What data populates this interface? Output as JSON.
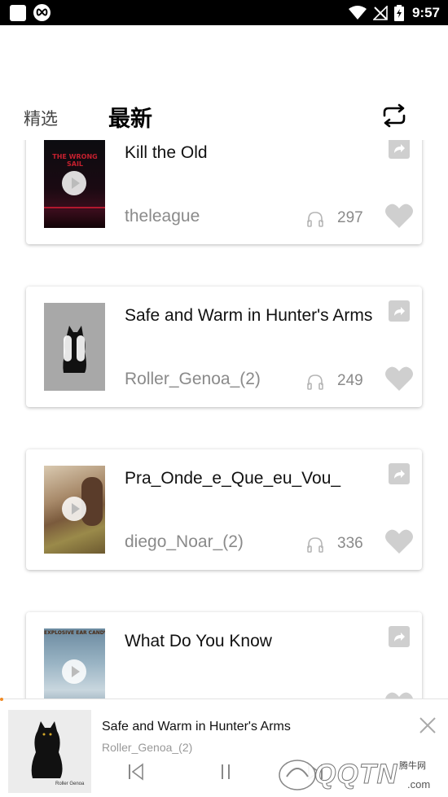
{
  "status_bar": {
    "time": "9:57"
  },
  "tabs": {
    "featured": "精选",
    "latest": "最新"
  },
  "tracks": [
    {
      "title": "Kill the Old",
      "author": "theleague",
      "plays": "297",
      "thumb_text": "THE WRONG SAIL"
    },
    {
      "title": "Safe and Warm in Hunter's Arms",
      "author": "Roller_Genoa_(2)",
      "plays": "249"
    },
    {
      "title": "Pra_Onde_e_Que_eu_Vou_",
      "author": "diego_Noar_(2)",
      "plays": "336"
    },
    {
      "title": "What Do You Know",
      "author": "",
      "plays": "",
      "thumb_text": "EXPLOSIVE EAR CANDY"
    }
  ],
  "player": {
    "title": "Safe and Warm in Hunter's Arms",
    "artist": "Roller_Genoa_(2)",
    "art_caption": "Roller Genoa"
  },
  "watermark": {
    "logo": "QQTN",
    "sub": "腾牛网",
    "domain": ".com"
  },
  "colors": {
    "accent": "#f08a24",
    "icon_gray": "#cfcfcf",
    "secondary_text": "#8a8a8a"
  },
  "icons": [
    "white-square-icon",
    "infinity-icon",
    "wifi-icon",
    "no-signal-icon",
    "battery-icon",
    "refresh-icon",
    "play-icon",
    "pause-icon",
    "share-icon",
    "headphones-icon",
    "heart-icon",
    "close-icon",
    "previous-icon",
    "next-icon"
  ]
}
